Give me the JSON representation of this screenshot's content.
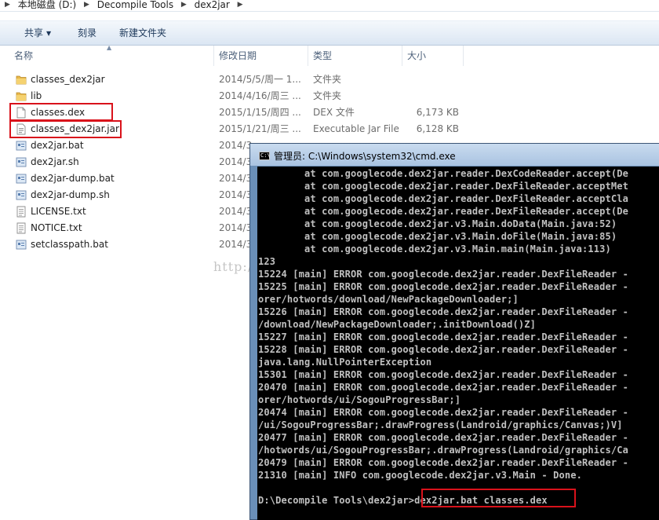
{
  "address_bar": {
    "crumbs": [
      "本地磁盘 (D:)",
      "Decompile Tools",
      "dex2jar"
    ]
  },
  "toolbar": {
    "share_label": "共享",
    "burn_label": "刻录",
    "new_folder_label": "新建文件夹"
  },
  "columns": {
    "name": "名称",
    "date": "修改日期",
    "type": "类型",
    "size": "大小"
  },
  "files": [
    {
      "name": "classes_dex2jar",
      "date": "2014/5/5/周一 1...",
      "type": "文件夹",
      "size": "",
      "icon": "folder-icon"
    },
    {
      "name": "lib",
      "date": "2014/4/16/周三 ...",
      "type": "文件夹",
      "size": "",
      "icon": "folder-icon"
    },
    {
      "name": "classes.dex",
      "date": "2015/1/15/周四 ...",
      "type": "DEX 文件",
      "size": "6,173 KB",
      "icon": "file-icon"
    },
    {
      "name": "classes_dex2jar.jar",
      "date": "2015/1/21/周三 ...",
      "type": "Executable Jar File",
      "size": "6,128 KB",
      "icon": "jar-file-icon"
    },
    {
      "name": "dex2jar.bat",
      "date": "2014/3",
      "type": "",
      "size": "",
      "icon": "batch-file-icon"
    },
    {
      "name": "dex2jar.sh",
      "date": "2014/3",
      "type": "",
      "size": "",
      "icon": "script-file-icon"
    },
    {
      "name": "dex2jar-dump.bat",
      "date": "2014/3",
      "type": "",
      "size": "",
      "icon": "batch-file-icon"
    },
    {
      "name": "dex2jar-dump.sh",
      "date": "2014/3",
      "type": "",
      "size": "",
      "icon": "script-file-icon"
    },
    {
      "name": "LICENSE.txt",
      "date": "2014/3",
      "type": "",
      "size": "",
      "icon": "text-file-icon"
    },
    {
      "name": "NOTICE.txt",
      "date": "2014/3",
      "type": "",
      "size": "",
      "icon": "text-file-icon"
    },
    {
      "name": "setclasspath.bat",
      "date": "2014/3",
      "type": "",
      "size": "",
      "icon": "batch-file-icon"
    }
  ],
  "watermark": "http://blog.csdn.net/lsmfeixiang",
  "cmd": {
    "title": "管理员: C:\\Windows\\system32\\cmd.exe",
    "icon_text": "C:\\",
    "lines": [
      "        at com.googlecode.dex2jar.reader.DexCodeReader.accept(De",
      "        at com.googlecode.dex2jar.reader.DexFileReader.acceptMet",
      "        at com.googlecode.dex2jar.reader.DexFileReader.acceptCla",
      "        at com.googlecode.dex2jar.reader.DexFileReader.accept(De",
      "        at com.googlecode.dex2jar.v3.Main.doData(Main.java:52)",
      "        at com.googlecode.dex2jar.v3.Main.doFile(Main.java:85)",
      "        at com.googlecode.dex2jar.v3.Main.main(Main.java:113)",
      "123",
      "15224 [main] ERROR com.googlecode.dex2jar.reader.DexFileReader -",
      "15225 [main] ERROR com.googlecode.dex2jar.reader.DexFileReader -",
      "orer/hotwords/download/NewPackageDownloader;]",
      "15226 [main] ERROR com.googlecode.dex2jar.reader.DexFileReader -",
      "/download/NewPackageDownloader;.initDownload()Z]",
      "15227 [main] ERROR com.googlecode.dex2jar.reader.DexFileReader -",
      "15228 [main] ERROR com.googlecode.dex2jar.reader.DexFileReader -",
      "java.lang.NullPointerException",
      "15301 [main] ERROR com.googlecode.dex2jar.reader.DexFileReader -",
      "20470 [main] ERROR com.googlecode.dex2jar.reader.DexFileReader -",
      "orer/hotwords/ui/SogouProgressBar;]",
      "20474 [main] ERROR com.googlecode.dex2jar.reader.DexFileReader -",
      "/ui/SogouProgressBar;.drawProgress(Landroid/graphics/Canvas;)V]",
      "20477 [main] ERROR com.googlecode.dex2jar.reader.DexFileReader -",
      "/hotwords/ui/SogouProgressBar;.drawProgress(Landroid/graphics/Ca",
      "20479 [main] ERROR com.googlecode.dex2jar.reader.DexFileReader -",
      "21310 [main] INFO com.googlecode.dex2jar.v3.Main - Done.",
      "",
      "D:\\Decompile Tools\\dex2jar>dex2jar.bat classes.dex"
    ]
  }
}
